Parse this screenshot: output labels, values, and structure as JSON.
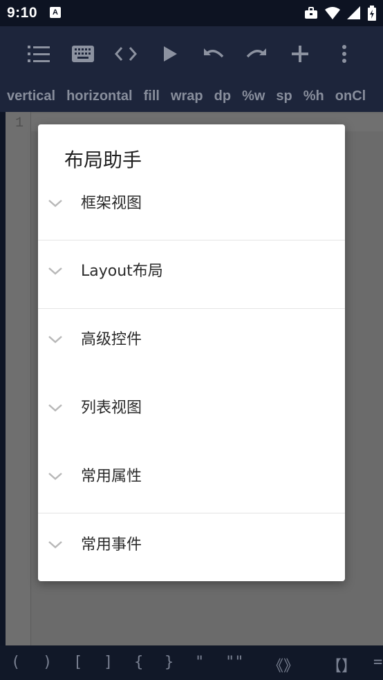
{
  "status_bar": {
    "time": "9:10",
    "notification_badge": "A",
    "icons": [
      "briefcase-icon",
      "wifi-icon",
      "signal-icon",
      "battery-charging-icon"
    ]
  },
  "toolbar": {
    "buttons": [
      {
        "name": "list-icon"
      },
      {
        "name": "keyboard-icon"
      },
      {
        "name": "code-icon"
      },
      {
        "name": "play-icon"
      },
      {
        "name": "undo-icon"
      },
      {
        "name": "redo-icon"
      },
      {
        "name": "add-icon"
      },
      {
        "name": "more-vert-icon"
      }
    ]
  },
  "snippets": [
    "vertical",
    "horizontal",
    "fill",
    "wrap",
    "dp",
    "%w",
    "sp",
    "%h",
    "onCl"
  ],
  "editor": {
    "line_numbers": [
      "1"
    ]
  },
  "dialog": {
    "title": "布局助手",
    "groups": [
      {
        "label": "框架视图"
      },
      {
        "label": "Layout布局"
      },
      {
        "label": "高级控件"
      },
      {
        "label": "列表视图"
      },
      {
        "label": "常用属性"
      },
      {
        "label": "常用事件"
      }
    ]
  },
  "symbol_bar": [
    "(",
    ")",
    "[",
    "]",
    "{",
    "}",
    "\"",
    "\"\"",
    "《》",
    "【】",
    "="
  ],
  "colors": {
    "toolbar_bg": "#1d253b",
    "status_bg": "#0d1322",
    "icon": "#8c92a0",
    "dialog_bg": "#ffffff",
    "overlay": "#6b6b6b"
  }
}
